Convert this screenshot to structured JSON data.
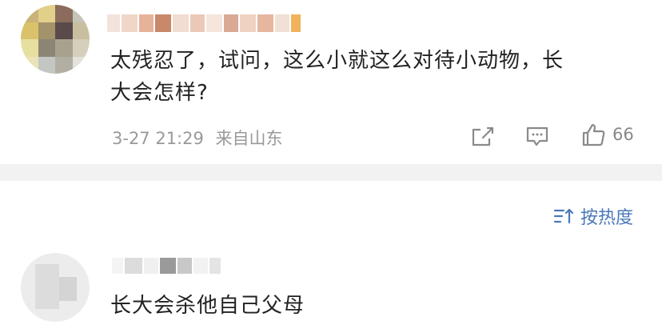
{
  "comments": [
    {
      "text_line1": "太残忍了，试问，这么小就这么对待小动物，长",
      "text_line2": "大会怎样?",
      "timestamp": "3-27 21:29",
      "location": "来自山东",
      "likes": "66",
      "icons": [
        "share-icon",
        "comment-icon",
        "like-icon"
      ]
    },
    {
      "text": "长大会杀他自己父母"
    }
  ],
  "sort": {
    "label": "按热度",
    "icon": "sort-icon"
  },
  "colors": {
    "accent": "#4a78b8",
    "meta": "#999999",
    "divider": "#f2f2f2"
  }
}
